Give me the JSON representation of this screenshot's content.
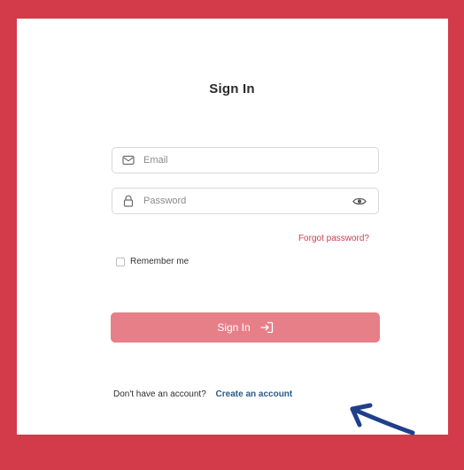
{
  "signin": {
    "title": "Sign In",
    "email": {
      "placeholder": "Email",
      "value": ""
    },
    "password": {
      "placeholder": "Password",
      "value": ""
    },
    "forgot_label": "Forgot password?",
    "remember_label": "Remember me",
    "button_label": "Sign In",
    "no_account_text": "Don't have an account?",
    "create_label": "Create an account"
  },
  "colors": {
    "border_frame": "#d33a4a",
    "button_bg": "#e77f89",
    "forgot_link": "#c9404f",
    "create_link": "#2d5a8a",
    "arrow": "#1f3f8a"
  },
  "icons": {
    "email": "mail-icon",
    "password": "lock-icon",
    "toggle": "eye-icon",
    "signin": "login-arrow-icon",
    "annotation": "pointer-arrow-icon"
  }
}
